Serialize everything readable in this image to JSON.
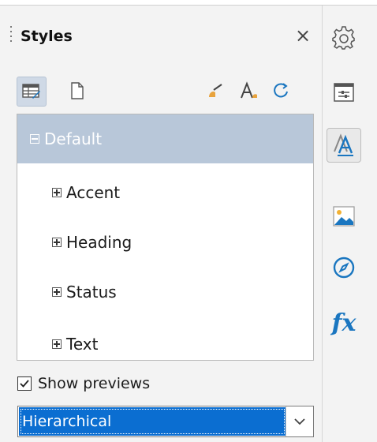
{
  "panel": {
    "title": "Styles",
    "close_glyph": "×"
  },
  "toolbar": {
    "left_icons": [
      "paragraph-styles-icon",
      "page-styles-icon"
    ],
    "right_icons": [
      "fill-format-icon",
      "new-style-icon",
      "update-style-icon"
    ]
  },
  "tree": {
    "items": [
      {
        "label": "Default",
        "expander": "minus",
        "selected": true,
        "level": 0
      },
      {
        "label": "Accent",
        "expander": "plus",
        "selected": false,
        "level": 1
      },
      {
        "label": "Heading",
        "expander": "plus",
        "selected": false,
        "level": 1
      },
      {
        "label": "Status",
        "expander": "plus",
        "selected": false,
        "level": 1
      },
      {
        "label": "Text",
        "expander": "plus",
        "selected": false,
        "level": 1
      }
    ]
  },
  "previews": {
    "label": "Show previews",
    "checked": true
  },
  "filter": {
    "value": "Hierarchical"
  },
  "deck": {
    "items": [
      "settings-gear-icon",
      "properties-icon",
      "styles-icon",
      "gallery-icon",
      "navigator-icon",
      "functions-icon"
    ],
    "active": "styles-icon",
    "functions_label": "fx"
  },
  "colors": {
    "accent": "#0b6ed1",
    "selection": "#b8c7d9",
    "icon_blue": "#1a76c0"
  }
}
